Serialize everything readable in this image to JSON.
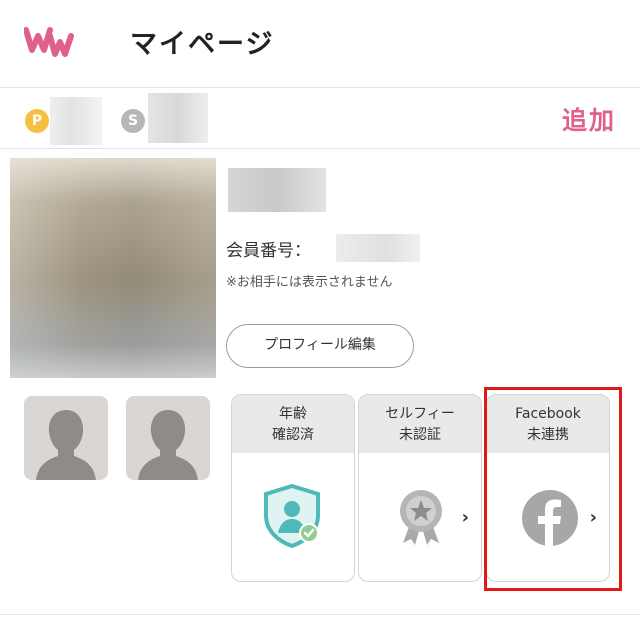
{
  "header": {
    "title": "マイページ",
    "logo_name": "ww-logo"
  },
  "points": {
    "p_coin": "P",
    "s_coin": "S",
    "add_label": "追加"
  },
  "profile": {
    "member_number_label": "会員番号：",
    "notice": "※お相手には表示されません",
    "edit_button": "プロフィール編集"
  },
  "verification": {
    "cards": [
      {
        "line1": "年齢",
        "line2": "確認済",
        "icon": "id-shield-verified-icon",
        "has_chevron": false
      },
      {
        "line1": "セルフィー",
        "line2": "未認証",
        "icon": "medal-star-icon",
        "has_chevron": true
      },
      {
        "line1": "Facebook",
        "line2": "未連携",
        "icon": "facebook-icon",
        "has_chevron": true
      }
    ],
    "chevron": "›"
  },
  "colors": {
    "accent": "#e0608c",
    "highlight": "#e01818",
    "verified_teal": "#4fb8b8"
  }
}
